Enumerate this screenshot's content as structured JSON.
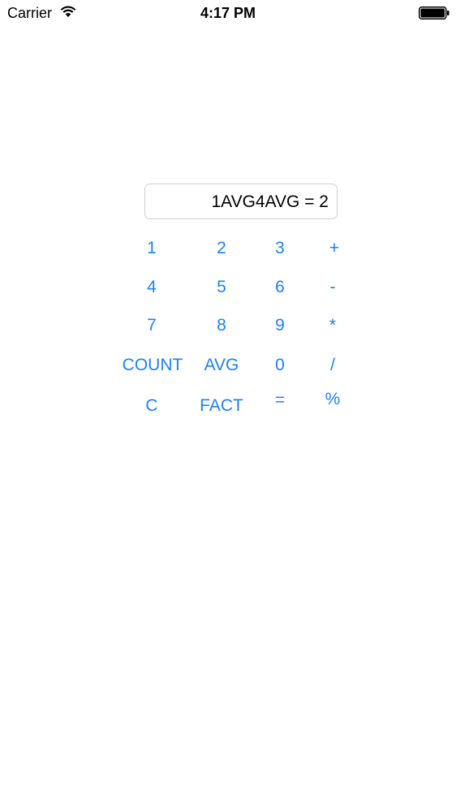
{
  "status_bar": {
    "carrier": "Carrier",
    "time": "4:17 PM",
    "wifi_icon": "wifi-icon",
    "battery_icon": "battery-icon"
  },
  "display": {
    "text": "1AVG4AVG = 2"
  },
  "keypad": {
    "accent_color": "#1a82fb",
    "keys": {
      "k1": "1",
      "k2": "2",
      "k3": "3",
      "plus": "+",
      "k4": "4",
      "k5": "5",
      "k6": "6",
      "minus": "-",
      "k7": "7",
      "k8": "8",
      "k9": "9",
      "multiply": "*",
      "count": "COUNT",
      "avg": "AVG",
      "k0": "0",
      "divide": "/",
      "clear": "C",
      "fact": "FACT",
      "equals": "=",
      "percent": "%"
    }
  }
}
